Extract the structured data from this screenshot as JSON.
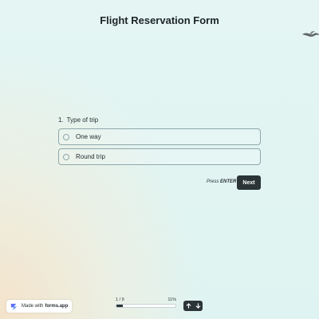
{
  "form": {
    "title": "Flight Reservation Form"
  },
  "question": {
    "number": "1.",
    "label": "Type of trip",
    "options": [
      {
        "label": "One way",
        "selected": false
      },
      {
        "label": "Round trip",
        "selected": false
      }
    ]
  },
  "actions": {
    "press_prefix": "Press",
    "press_key": "ENTER",
    "next_label": "Next"
  },
  "footer": {
    "made_with_prefix": "Made with",
    "made_with_brand": "forms.app",
    "progress_count": "1 / 9",
    "progress_percent": "11%",
    "progress_value": 0.11,
    "nav_up_icon": "arrow-up-icon",
    "nav_down_icon": "arrow-down-icon"
  },
  "colors": {
    "accent": "#2b3436",
    "option_border": "#8fa8aa",
    "background": "#dff4f2",
    "warm_corner": "#f6e2c8",
    "brand_logo_start": "#6a5cf5",
    "brand_logo_end": "#3ea7f0"
  }
}
